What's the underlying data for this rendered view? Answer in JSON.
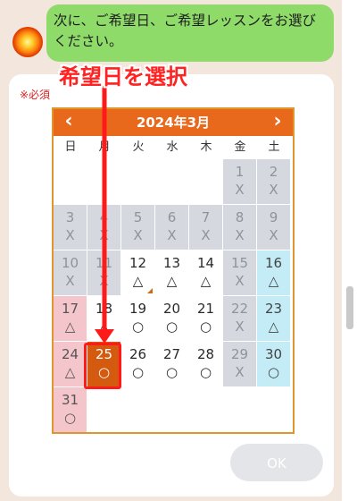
{
  "chat": {
    "message": "次に、ご希望日、ご希望レッスンをお選びください。"
  },
  "form": {
    "required_label": "※必須",
    "ok_label": "OK"
  },
  "calendar": {
    "title": "2024年3月",
    "prev_symbol": "‹",
    "next_symbol": "›",
    "weekdays": [
      "日",
      "月",
      "火",
      "水",
      "木",
      "金",
      "土"
    ],
    "days": [
      {
        "day": "1",
        "mark": "X",
        "status": "unavailable"
      },
      {
        "day": "2",
        "mark": "X",
        "status": "unavailable"
      },
      {
        "day": "3",
        "mark": "X",
        "status": "unavailable"
      },
      {
        "day": "4",
        "mark": "X",
        "status": "unavailable"
      },
      {
        "day": "5",
        "mark": "X",
        "status": "unavailable"
      },
      {
        "day": "6",
        "mark": "X",
        "status": "unavailable"
      },
      {
        "day": "7",
        "mark": "X",
        "status": "unavailable"
      },
      {
        "day": "8",
        "mark": "X",
        "status": "unavailable"
      },
      {
        "day": "9",
        "mark": "X",
        "status": "unavailable"
      },
      {
        "day": "10",
        "mark": "X",
        "status": "unavailable"
      },
      {
        "day": "11",
        "mark": "X",
        "status": "unavailable"
      },
      {
        "day": "12",
        "mark": "△",
        "status": "open"
      },
      {
        "day": "13",
        "mark": "△",
        "status": "open"
      },
      {
        "day": "14",
        "mark": "△",
        "status": "open"
      },
      {
        "day": "15",
        "mark": "X",
        "status": "unavailable"
      },
      {
        "day": "16",
        "mark": "△",
        "status": "open"
      },
      {
        "day": "17",
        "mark": "△",
        "status": "open"
      },
      {
        "day": "18",
        "mark": "△",
        "status": "open"
      },
      {
        "day": "19",
        "mark": "○",
        "status": "open"
      },
      {
        "day": "20",
        "mark": "○",
        "status": "open"
      },
      {
        "day": "21",
        "mark": "○",
        "status": "open"
      },
      {
        "day": "22",
        "mark": "X",
        "status": "unavailable"
      },
      {
        "day": "23",
        "mark": "△",
        "status": "open"
      },
      {
        "day": "24",
        "mark": "△",
        "status": "open"
      },
      {
        "day": "25",
        "mark": "○",
        "status": "selected"
      },
      {
        "day": "26",
        "mark": "○",
        "status": "open"
      },
      {
        "day": "27",
        "mark": "○",
        "status": "open"
      },
      {
        "day": "28",
        "mark": "○",
        "status": "open"
      },
      {
        "day": "29",
        "mark": "X",
        "status": "unavailable"
      },
      {
        "day": "30",
        "mark": "○",
        "status": "open"
      },
      {
        "day": "31",
        "mark": "○",
        "status": "open"
      }
    ]
  },
  "annotation": {
    "label": "希望日を選択"
  },
  "colors": {
    "header": "#e8691c",
    "selected": "#d45a10",
    "bubble": "#8fdb6a",
    "annotation": "#ff1a1a"
  }
}
